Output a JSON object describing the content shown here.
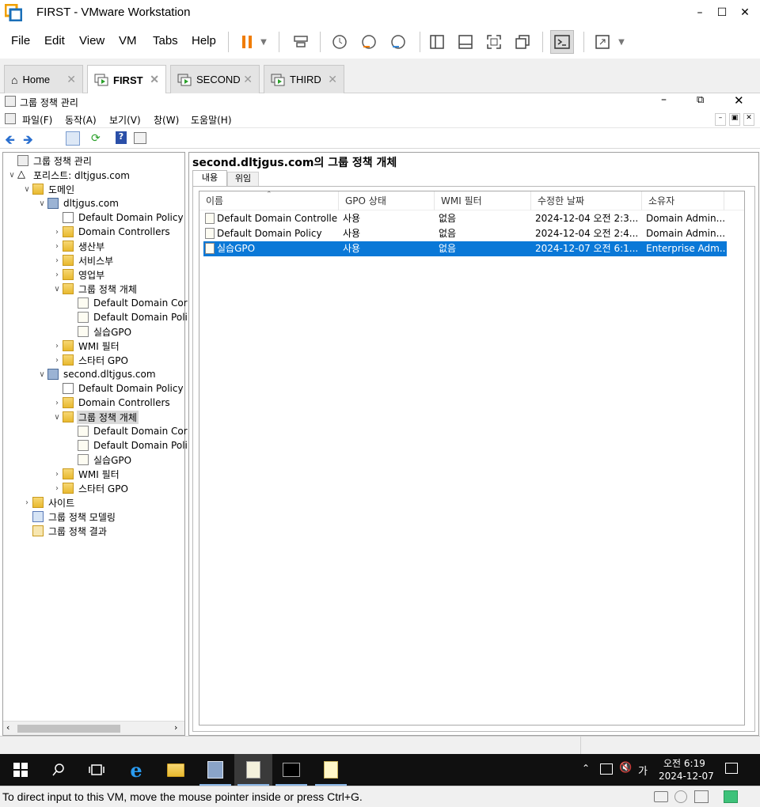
{
  "vmware": {
    "title": "FIRST - VMware Workstation",
    "menu": [
      "File",
      "Edit",
      "View",
      "VM",
      "Tabs",
      "Help"
    ],
    "tabs": [
      {
        "label": "Home",
        "active": false
      },
      {
        "label": "FIRST",
        "active": true
      },
      {
        "label": "SECOND",
        "active": false
      },
      {
        "label": "THIRD",
        "active": false
      }
    ],
    "status_text": "To direct input to this VM, move the mouse pointer inside or press Ctrl+G."
  },
  "mmc": {
    "title": "그룹 정책 관리",
    "menu": [
      "파일(F)",
      "동작(A)",
      "보기(V)",
      "창(W)",
      "도움말(H)"
    ],
    "tree": [
      {
        "label": "그룹 정책 관리",
        "depth": 0,
        "exp": "",
        "icon": "gpm-icon"
      },
      {
        "label": "포리스트: dltjgus.com",
        "depth": 0,
        "exp": "v",
        "icon": "forest-icon"
      },
      {
        "label": "도메인",
        "depth": 1,
        "exp": "v",
        "icon": "folder-icon"
      },
      {
        "label": "dltjgus.com",
        "depth": 2,
        "exp": "v",
        "icon": "domain-icon"
      },
      {
        "label": "Default Domain Policy",
        "depth": 3,
        "exp": "",
        "icon": "gpo-link-icon"
      },
      {
        "label": "Domain Controllers",
        "depth": 3,
        "exp": ">",
        "icon": "ou-icon"
      },
      {
        "label": "생산부",
        "depth": 3,
        "exp": ">",
        "icon": "ou-icon"
      },
      {
        "label": "서비스부",
        "depth": 3,
        "exp": ">",
        "icon": "ou-icon"
      },
      {
        "label": "영업부",
        "depth": 3,
        "exp": ">",
        "icon": "ou-icon"
      },
      {
        "label": "그룹 정책 개체",
        "depth": 3,
        "exp": "v",
        "icon": "folder-icon"
      },
      {
        "label": "Default Domain Cor",
        "depth": 4,
        "exp": "",
        "icon": "gpo-icon"
      },
      {
        "label": "Default Domain Poli",
        "depth": 4,
        "exp": "",
        "icon": "gpo-icon"
      },
      {
        "label": "실습GPO",
        "depth": 4,
        "exp": "",
        "icon": "gpo-icon"
      },
      {
        "label": "WMI 필터",
        "depth": 3,
        "exp": ">",
        "icon": "folder-icon"
      },
      {
        "label": "스타터 GPO",
        "depth": 3,
        "exp": ">",
        "icon": "folder-icon"
      },
      {
        "label": "second.dltjgus.com",
        "depth": 2,
        "exp": "v",
        "icon": "domain-icon"
      },
      {
        "label": "Default Domain Policy",
        "depth": 3,
        "exp": "",
        "icon": "gpo-link-icon"
      },
      {
        "label": "Domain Controllers",
        "depth": 3,
        "exp": ">",
        "icon": "ou-icon"
      },
      {
        "label": "그룹 정책 개체",
        "depth": 3,
        "exp": "v",
        "icon": "folder-icon",
        "selected": true
      },
      {
        "label": "Default Domain Cor",
        "depth": 4,
        "exp": "",
        "icon": "gpo-icon"
      },
      {
        "label": "Default Domain Poli",
        "depth": 4,
        "exp": "",
        "icon": "gpo-icon"
      },
      {
        "label": "실습GPO",
        "depth": 4,
        "exp": "",
        "icon": "gpo-icon"
      },
      {
        "label": "WMI 필터",
        "depth": 3,
        "exp": ">",
        "icon": "folder-icon"
      },
      {
        "label": "스타터 GPO",
        "depth": 3,
        "exp": ">",
        "icon": "folder-icon"
      },
      {
        "label": "사이트",
        "depth": 1,
        "exp": ">",
        "icon": "folder-icon"
      },
      {
        "label": "그룹 정책 모델링",
        "depth": 1,
        "exp": "",
        "icon": "modeling-icon"
      },
      {
        "label": "그룹 정책 결과",
        "depth": 1,
        "exp": "",
        "icon": "results-icon"
      }
    ],
    "panel_title": "second.dltjgus.com의 그룹 정책 개체",
    "panel_tabs": [
      "내용",
      "위임"
    ],
    "columns": [
      "이름",
      "GPO 상태",
      "WMI 필터",
      "수정한 날짜",
      "소유자"
    ],
    "rows": [
      [
        "Default Domain Controlle...",
        "사용",
        "없음",
        "2024-12-04 오전 2:3...",
        "Domain Admin..."
      ],
      [
        "Default Domain Policy",
        "사용",
        "없음",
        "2024-12-04 오전 2:4...",
        "Domain Admin..."
      ],
      [
        "실습GPO",
        "사용",
        "없음",
        "2024-12-07 오전 6:1...",
        "Enterprise Adm..."
      ]
    ],
    "selected_row": 2
  },
  "taskbar": {
    "time": "오전 6:19",
    "date": "2024-12-07",
    "ime": "가"
  },
  "colors": {
    "selection": "#0a78d7",
    "accent": "#f07c00"
  }
}
